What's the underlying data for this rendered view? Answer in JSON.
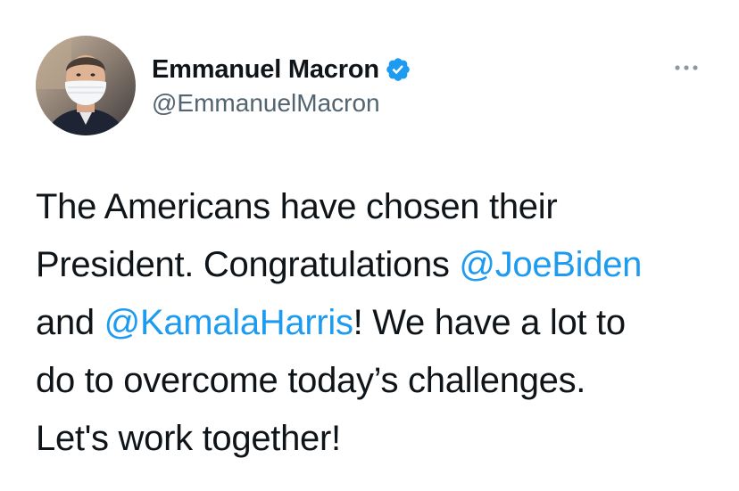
{
  "author": {
    "display_name": "Emmanuel Macron",
    "handle": "@EmmanuelMacron",
    "verified": true
  },
  "tweet": {
    "segments": [
      {
        "type": "text",
        "value": "The Americans have chosen their"
      },
      {
        "type": "break"
      },
      {
        "type": "text",
        "value": "President. Congratulations "
      },
      {
        "type": "mention",
        "value": "@JoeBiden"
      },
      {
        "type": "break"
      },
      {
        "type": "text",
        "value": "and "
      },
      {
        "type": "mention",
        "value": "@KamalaHarris"
      },
      {
        "type": "text",
        "value": "! We have a lot to"
      },
      {
        "type": "break"
      },
      {
        "type": "text",
        "value": "do to overcome today’s challenges."
      },
      {
        "type": "break"
      },
      {
        "type": "text",
        "value": "Let's work together!"
      }
    ]
  },
  "icons": {
    "verified": "verified-badge-icon",
    "more": "more-options-icon"
  },
  "colors": {
    "link": "#1d9bf0",
    "text": "#0f1419",
    "secondary": "#536471",
    "background": "#ffffff"
  }
}
